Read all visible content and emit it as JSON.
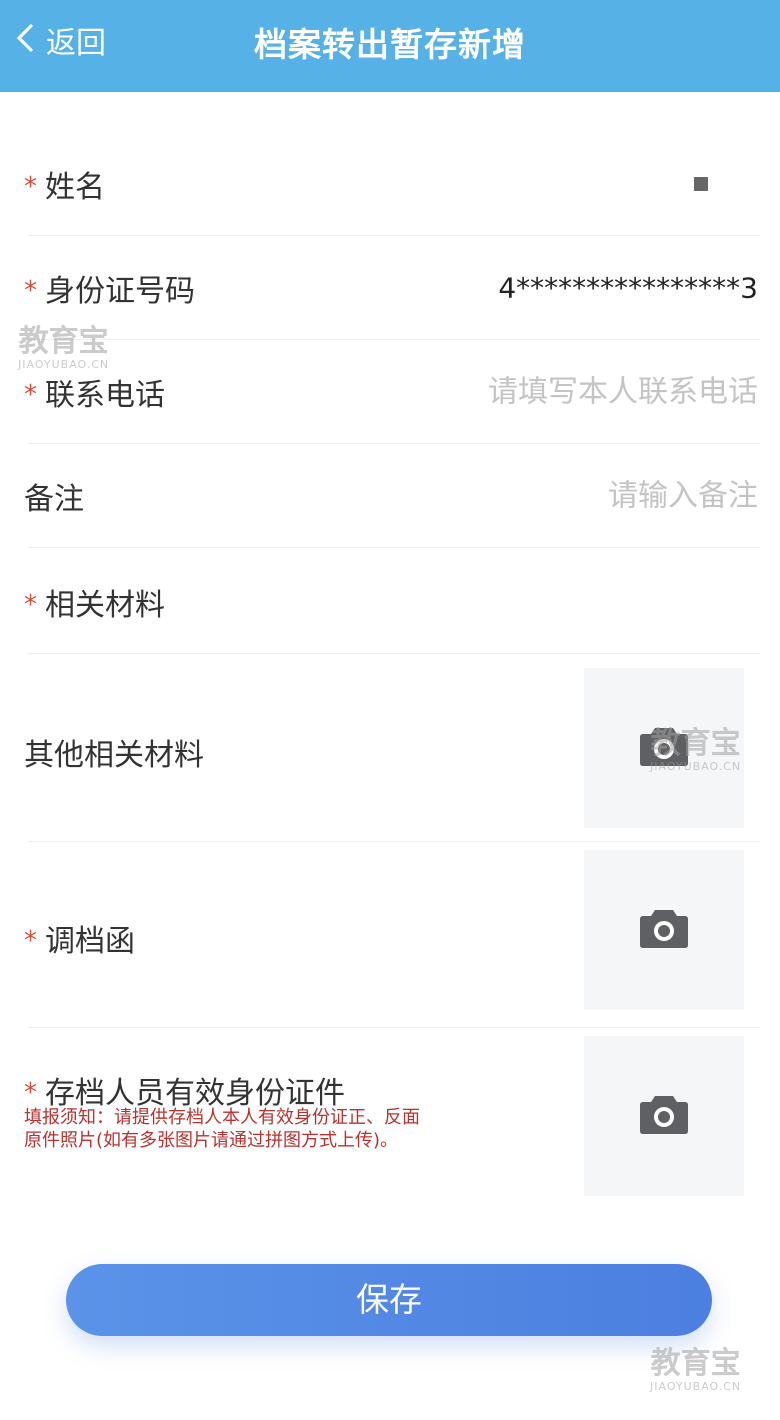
{
  "header": {
    "back_label": "返回",
    "title": "档案转出暂存新增"
  },
  "form": {
    "required_mark": "*",
    "name": {
      "label": "姓名",
      "value_masked": true
    },
    "id_number": {
      "label": "身份证号码",
      "value": "4****************3"
    },
    "phone": {
      "label": "联系电话",
      "value": "",
      "placeholder": "请填写本人联系电话"
    },
    "remark": {
      "label": "备注",
      "value": "",
      "placeholder": "请输入备注"
    },
    "materials": {
      "label": "相关材料"
    },
    "other_materials": {
      "label": "其他相关材料"
    },
    "transfer_letter": {
      "label": "调档函"
    },
    "id_docs": {
      "label": "存档人员有效身份证件",
      "notice": "填报须知：请提供存档人本人有效身份证正、反面原件照片(如有多张图片请通过拼图方式上传)。"
    }
  },
  "actions": {
    "save_label": "保存"
  },
  "watermark": {
    "main": "教育宝",
    "sub": "JIAOYUBAO.CN"
  },
  "colors": {
    "header_bg": "#55b1e6",
    "required": "#d9503c",
    "notice": "#b8322e",
    "save_button": "#4c7fe0"
  },
  "icons": {
    "back": "chevron-left-icon",
    "upload": "camera-icon"
  }
}
